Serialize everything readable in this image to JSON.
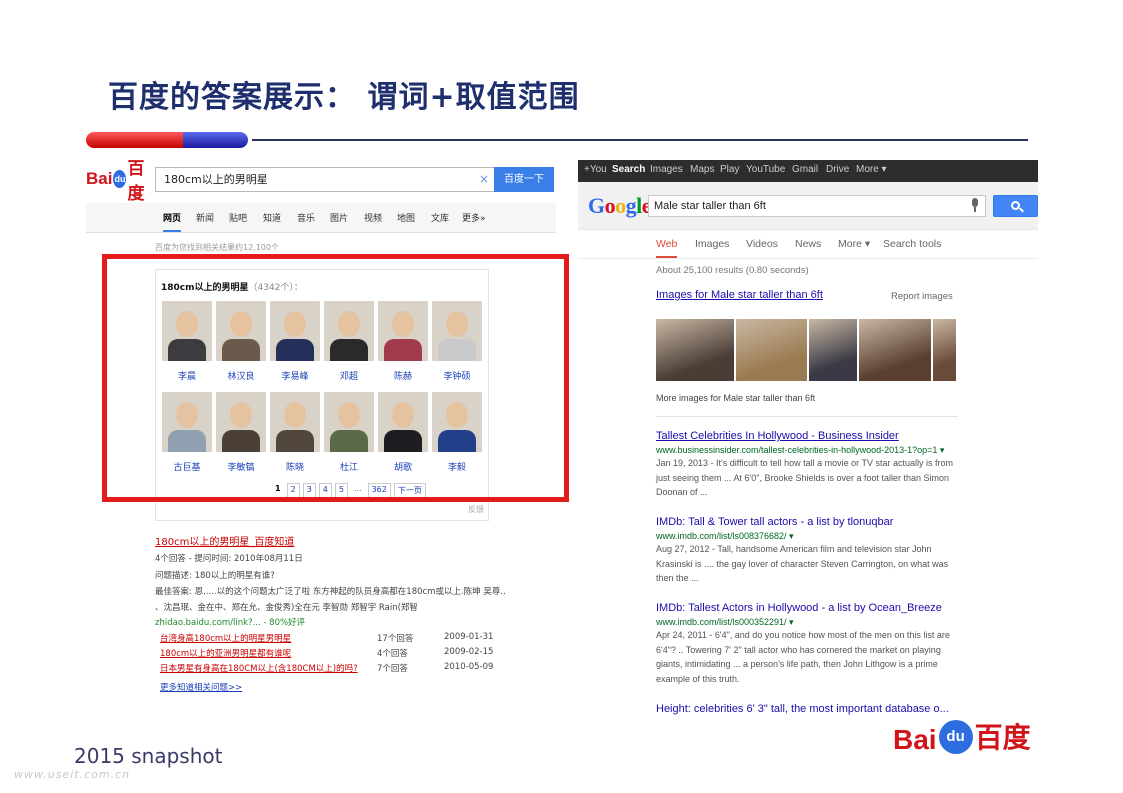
{
  "slide": {
    "title": "百度的答案展示： 谓词+取值范围",
    "snapshot": "2015 snapshot",
    "watermark": "www.useit.com.cn"
  },
  "baidu": {
    "logo": {
      "left": "Bai",
      "paw": "du",
      "right": "百度"
    },
    "search": {
      "value": "180cm以上的男明星",
      "clear": "×",
      "button": "百度一下"
    },
    "nav": [
      "网页",
      "新闻",
      "贴吧",
      "知道",
      "音乐",
      "图片",
      "视频",
      "地图",
      "文库",
      "更多»"
    ],
    "result_count": "百度为您找到相关结果约12,100个",
    "card": {
      "title": "180cm以上的男明星",
      "count": "（4342个）：",
      "people": [
        {
          "name": "李晨",
          "color": "#3b3b40"
        },
        {
          "name": "林汉良",
          "color": "#6a5a4c"
        },
        {
          "name": "李易峰",
          "color": "#24305a"
        },
        {
          "name": "邓超",
          "color": "#2a2a2a"
        },
        {
          "name": "陈赫",
          "color": "#a13a4a"
        },
        {
          "name": "李钟硕",
          "color": "#c9c9cc"
        },
        {
          "name": "古巨基",
          "color": "#8fa0b0"
        },
        {
          "name": "李敏镐",
          "color": "#4a4036"
        },
        {
          "name": "陈晓",
          "color": "#50463c"
        },
        {
          "name": "杜江",
          "color": "#5a6a48"
        },
        {
          "name": "胡歌",
          "color": "#1e1e22"
        },
        {
          "name": "李毅",
          "color": "#22408a"
        }
      ],
      "pager": [
        "1",
        "2",
        "3",
        "4",
        "5",
        "...",
        "362",
        "下一页"
      ],
      "feedback": "反馈"
    },
    "zhidao": {
      "title": "180cm以上的男明星_百度知道",
      "meta": "4个回答 - 提问时间: 2010年08月11日",
      "desc": "问题描述: 180以上的明星有谁?",
      "best": "最佳答案: 恩.....以的这个问题太广泛了啦 东方神起的队员身高都在180cm或以上.陈坤 吴尊..",
      "best2": "、沈昌珉、金在中、郑在允、金俊秀)全在元 李智勋 郑智宇 Rain(郑智",
      "link": "zhidao.baidu.com/link?... - 80%好评",
      "rows": [
        {
          "q": "台湾身高180cm以上的明星男明星",
          "n": "17个回答",
          "d": "2009-01-31"
        },
        {
          "q": "180cm以上的亚洲男明星都有谁呢",
          "n": "4个回答",
          "d": "2009-02-15"
        },
        {
          "q": "日本男星有身高在180CM以上(含180CM以上)的吗?",
          "n": "7个回答",
          "d": "2010-05-09"
        }
      ],
      "more": "更多知道相关问题>>"
    }
  },
  "google": {
    "topbar": [
      "+You",
      "Search",
      "Images",
      "Maps",
      "Play",
      "YouTube",
      "Gmail",
      "Drive",
      "More ▾"
    ],
    "logo": [
      {
        "ch": "G",
        "color": "#3369e8"
      },
      {
        "ch": "o",
        "color": "#d50f25"
      },
      {
        "ch": "o",
        "color": "#eeb211"
      },
      {
        "ch": "g",
        "color": "#3369e8"
      },
      {
        "ch": "l",
        "color": "#009925"
      },
      {
        "ch": "e",
        "color": "#d50f25"
      }
    ],
    "search": {
      "value": "Male star taller than 6ft"
    },
    "tabs": [
      "Web",
      "Images",
      "Videos",
      "News",
      "More ▾",
      "Search tools"
    ],
    "stats": "About 25,100 results (0.80 seconds)",
    "images_title": "Images for Male star taller than 6ft",
    "report": "Report images",
    "thumbs": [
      {
        "color": "#4a3d36"
      },
      {
        "color": "#9a7a50"
      },
      {
        "color": "#3a3a46"
      },
      {
        "color": "#5a3f2e"
      },
      {
        "color": "#6a4a3a"
      }
    ],
    "more_images": "More images for Male star taller than 6ft",
    "results": [
      {
        "title": "Tallest Celebrities In Hollywood - Business Insider",
        "url": "www.businessinsider.com/tallest-celebrities-in-hollywood-2013-1?op=1 ▾",
        "snippet": "Jan 19, 2013 - It's difficult to tell how tall a movie or TV star actually is from just seeing them ... At 6'0\", Brooke Shields is over a foot taller than Simon Doonan of ..."
      },
      {
        "title": "IMDb: Tall & Tower tall actors - a list by tlonuqbar",
        "url": "www.imdb.com/list/ls008376682/ ▾",
        "snippet": "Aug 27, 2012 - Tall, handsome American film and television star John Krasinski is .... the gay lover of character Steven Carrington, on what was then the ..."
      },
      {
        "title": "IMDb: Tallest Actors in Hollywood - a list by Ocean_Breeze",
        "url": "www.imdb.com/list/ls000352291/ ▾",
        "snippet": "Apr 24, 2011 - 6'4\", and do you notice how most of the men on this list are 6'4\"? .. Towering 7' 2\" tall actor who has cornered the market on playing giants, intimidating ... a person's life path, then John Lithgow is a prime example of this truth."
      },
      {
        "title": "Height: celebrities 6' 3\" tall, the most important database o...",
        "url": "",
        "snippet": ""
      }
    ]
  },
  "footer_logo": {
    "left": "Bai",
    "paw": "du",
    "right": "百度"
  }
}
